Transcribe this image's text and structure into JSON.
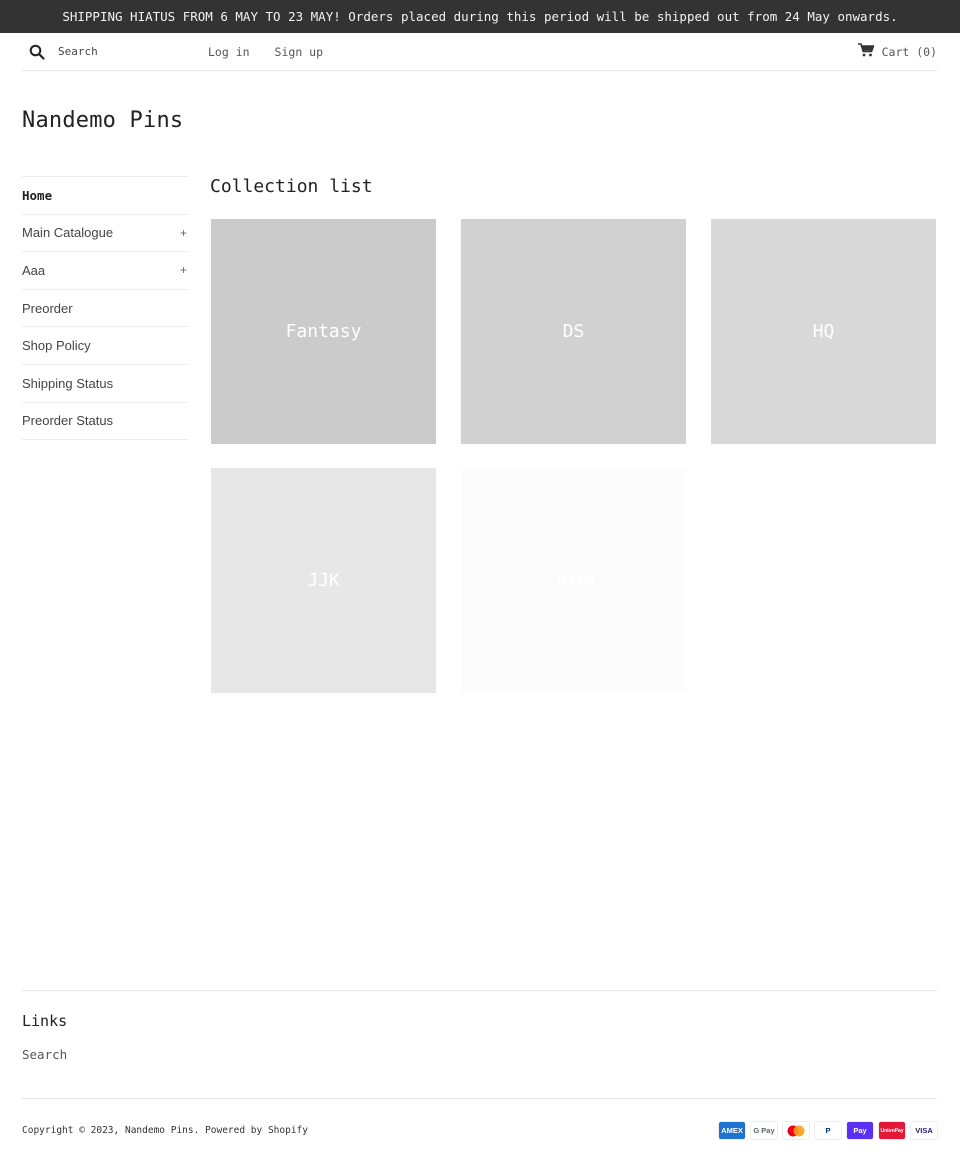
{
  "announcement": "SHIPPING HIATUS FROM 6 MAY TO 23 MAY! Orders placed during this period will be shipped out from 24 May onwards.",
  "header": {
    "search_placeholder": "Search",
    "login_label": "Log in",
    "signup_label": "Sign up",
    "cart_label": "Cart (0)"
  },
  "site_title": "Nandemo Pins",
  "sidebar": {
    "items": [
      {
        "label": "Home",
        "expandable": false,
        "active": true
      },
      {
        "label": "Main Catalogue",
        "expandable": true,
        "toggle": "+"
      },
      {
        "label": "Aaa",
        "expandable": true,
        "toggle": "+"
      },
      {
        "label": "Preorder",
        "expandable": false
      },
      {
        "label": "Shop Policy",
        "expandable": false
      },
      {
        "label": "Shipping Status",
        "expandable": false
      },
      {
        "label": "Preorder Status",
        "expandable": false
      }
    ]
  },
  "main": {
    "title": "Collection list",
    "collections": [
      {
        "label": "Fantasy",
        "color": "#cbcbcb"
      },
      {
        "label": "DS",
        "color": "#d1d1d1"
      },
      {
        "label": "HQ",
        "color": "#d8d8d8"
      },
      {
        "label": "JJK",
        "color": "#e7e7e7"
      },
      {
        "label": "JOJO",
        "color": "#fcfcfc"
      }
    ]
  },
  "footer": {
    "heading": "Links",
    "links": [
      "Search"
    ],
    "copyright_prefix": "Copyright © 2023,",
    "shop_name": "Nandemo Pins",
    "powered_by": ". Powered by Shopify",
    "payment_methods": [
      {
        "name": "American Express",
        "label": "AMEX",
        "bg": "#1f72cd",
        "fg": "#ffffff"
      },
      {
        "name": "Google Pay",
        "label": "G Pay",
        "bg": "#ffffff",
        "fg": "#5f6368"
      },
      {
        "name": "Mastercard",
        "label": "",
        "bg": "#ffffff",
        "fg": "#eb001b"
      },
      {
        "name": "PayPal",
        "label": "P",
        "bg": "#ffffff",
        "fg": "#003087"
      },
      {
        "name": "Shop Pay",
        "label": "Pay",
        "bg": "#5a31f4",
        "fg": "#ffffff"
      },
      {
        "name": "UnionPay",
        "label": "UnionPay",
        "bg": "#e21836",
        "fg": "#ffffff"
      },
      {
        "name": "Visa",
        "label": "VISA",
        "bg": "#ffffff",
        "fg": "#1a1f71"
      }
    ]
  }
}
